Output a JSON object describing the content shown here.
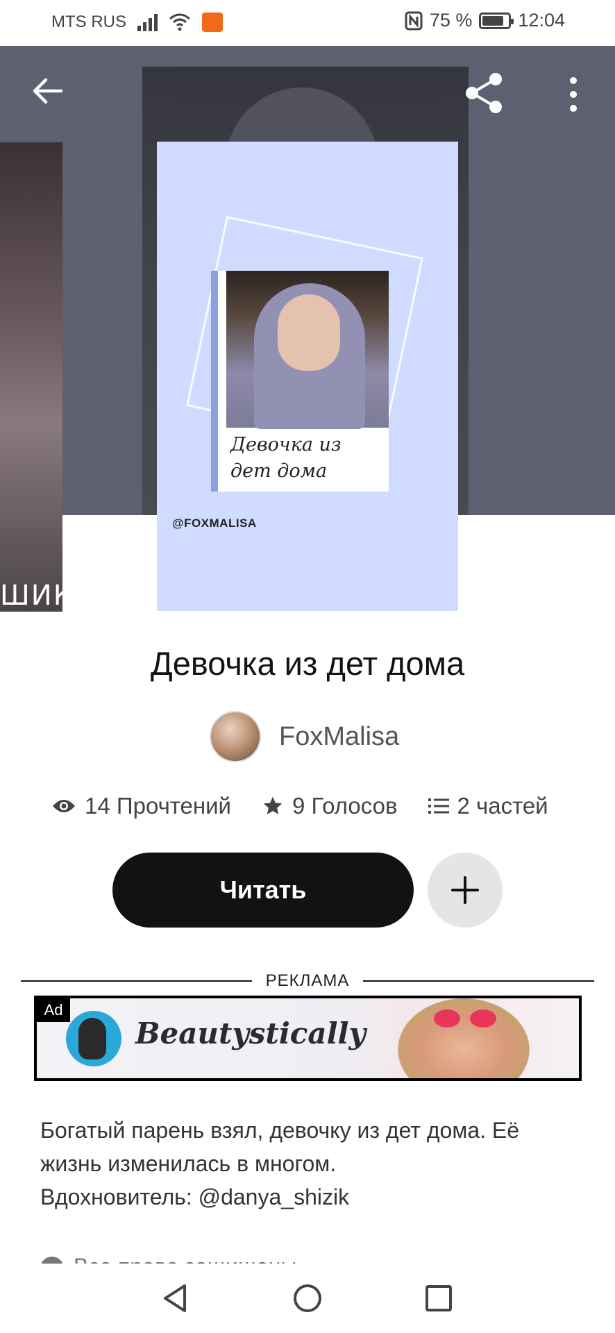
{
  "status_bar": {
    "carrier": "MTS RUS",
    "battery_percent": "75 %",
    "battery_level": 0.75,
    "time": "12:04",
    "icons": [
      "signal-icon",
      "wifi-icon",
      "app-notification-icon",
      "nfc-icon",
      "battery-icon"
    ]
  },
  "header": {
    "back_icon": "arrow-left-icon",
    "share_icon": "share-icon",
    "more_icon": "more-vertical-icon"
  },
  "cover": {
    "caption": "Девочка из дет дома",
    "handle": "@FOXMALISA",
    "side_cover_text": "ШИК"
  },
  "story": {
    "title": "Девочка из дет дома",
    "author": "FoxMalisa",
    "reads": "14 Прочтений",
    "votes": "9 Голосов",
    "parts": "2 частей",
    "read_button": "Читать"
  },
  "ad": {
    "label": "РЕКЛАМА",
    "tag": "Ad",
    "brand": "Beautystically"
  },
  "description": "Богатый парень взял, девочку из дет дома. Её\nжизнь изменилась в многом.\nВдохновитель: @danya_shizik",
  "rights": "Все права защищены",
  "colors": {
    "hero_bg": "#5d6070",
    "cover_bg": "#cfdcff",
    "primary_button": "#121212",
    "secondary_button": "#e5e5e8"
  }
}
